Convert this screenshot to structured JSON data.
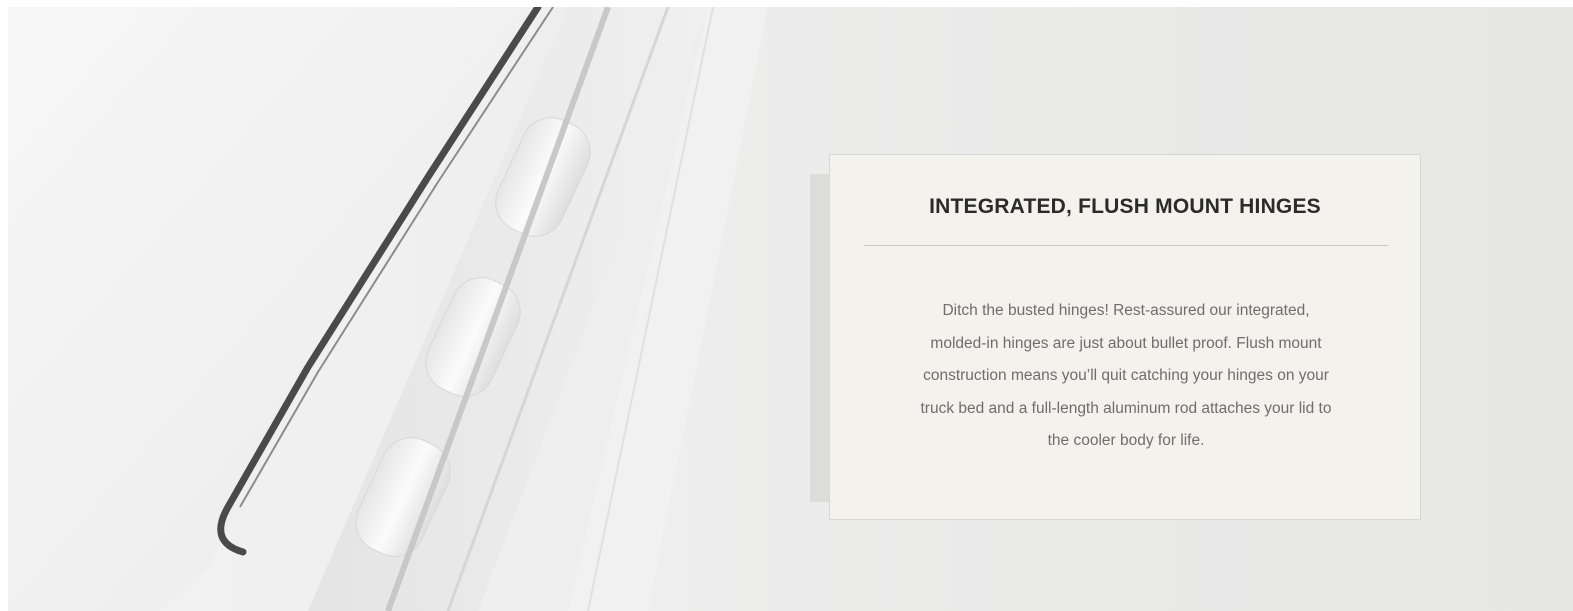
{
  "feature": {
    "title": "INTEGRATED, FLUSH MOUNT HINGES",
    "description_lines": [
      "Ditch the busted hinges!  Rest-assured our integrated,",
      "molded-in hinges are just about bullet proof.  Flush mount",
      "construction means you’ll quit catching your hinges on your",
      "truck bed and a full-length aluminum rod attaches your lid to",
      "the cooler body for life."
    ]
  },
  "colors": {
    "card_background": "#f3f2ec",
    "card_border": "#d9d8d2",
    "card_shadow": "#dcdcd9",
    "title_text": "#2b2b2b",
    "body_text": "#6e6e6b"
  },
  "icons": {
    "background_image": "cooler-lid-hinge-photo"
  }
}
